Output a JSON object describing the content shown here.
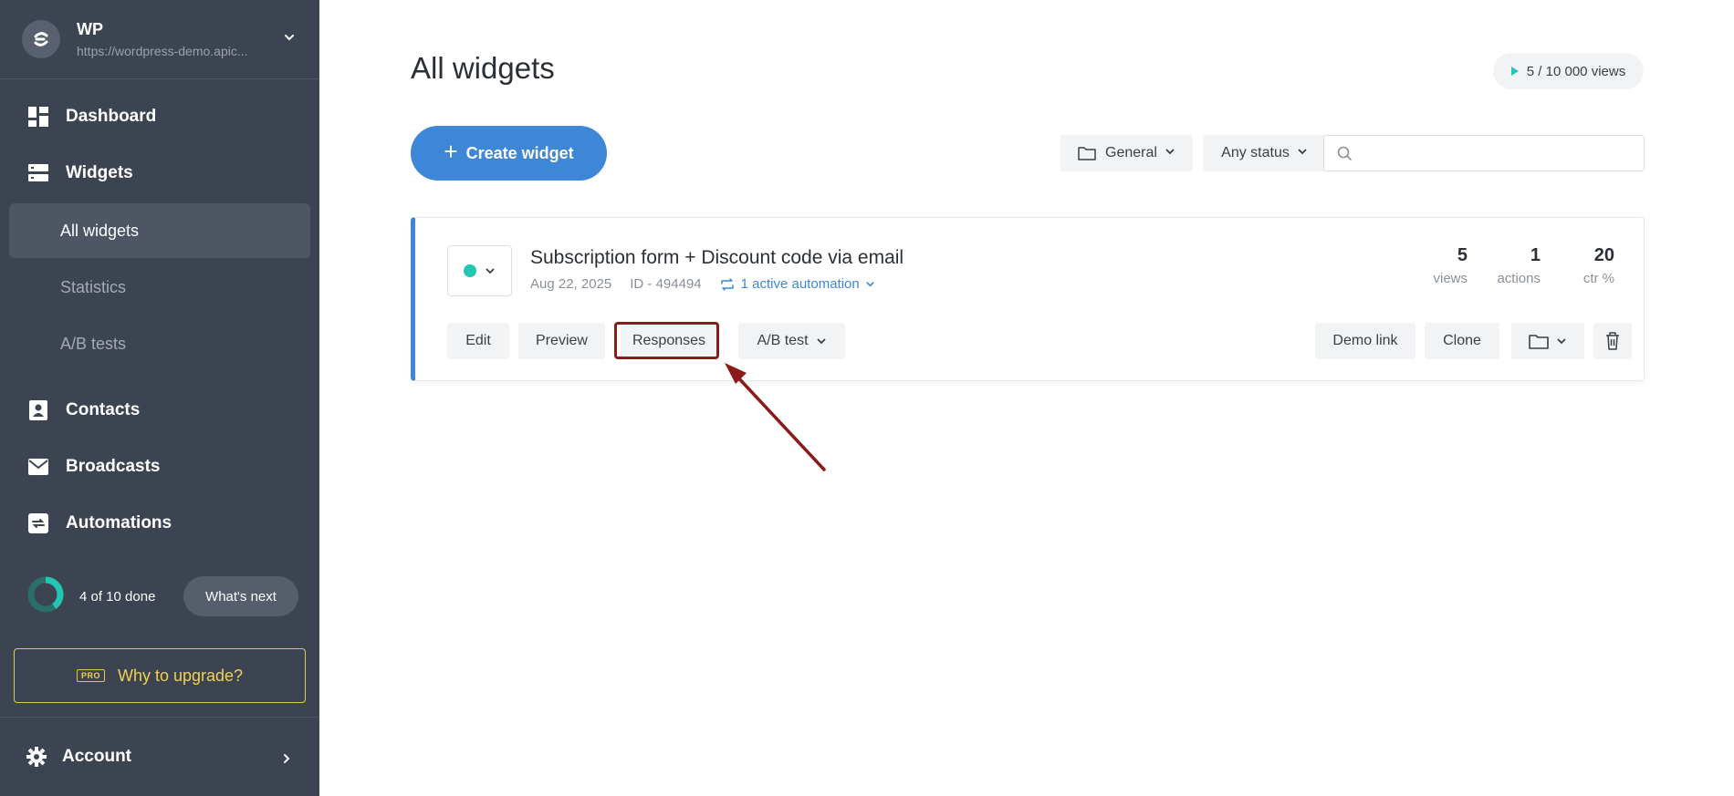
{
  "site": {
    "name": "WP",
    "url": "https://wordpress-demo.apic..."
  },
  "sidebar": {
    "items": [
      {
        "label": "Dashboard",
        "icon": "dashboard-icon"
      },
      {
        "label": "Widgets",
        "icon": "widgets-icon"
      },
      {
        "label": "Contacts",
        "icon": "contacts-icon"
      },
      {
        "label": "Broadcasts",
        "icon": "envelope-icon"
      },
      {
        "label": "Automations",
        "icon": "automations-icon"
      }
    ],
    "widget_subitems": [
      "All widgets",
      "Statistics",
      "A/B tests"
    ],
    "active_subitem": "All widgets",
    "progress": {
      "text": "4 of 10 done",
      "done": 4,
      "total": 10,
      "button": "What's next"
    },
    "upgrade": {
      "badge": "PRO",
      "label": "Why to upgrade?"
    },
    "account": {
      "label": "Account",
      "icon": "gear-icon"
    }
  },
  "main": {
    "title": "All widgets",
    "views_usage": "5 / 10 000 views",
    "create_button": "Create widget",
    "filters": {
      "folder": "General",
      "status": "Any status"
    },
    "search": {
      "placeholder": ""
    }
  },
  "widget": {
    "name": "Subscription form + Discount code via email",
    "date": "Aug 22, 2025",
    "id_label": "ID - 494494",
    "automation_label": "1 active automation",
    "status_color": "#21c7b0",
    "stats": [
      {
        "value": "5",
        "label": "views"
      },
      {
        "value": "1",
        "label": "actions"
      },
      {
        "value": "20",
        "label": "ctr %"
      }
    ],
    "actions": {
      "edit": "Edit",
      "preview": "Preview",
      "responses": "Responses",
      "ab_test": "A/B test",
      "demo_link": "Demo link",
      "clone": "Clone"
    }
  },
  "colors": {
    "sidebar_bg": "#3d4451",
    "accent_blue": "#3d87d6",
    "status_teal": "#21c7b0",
    "upgrade_yellow": "#f1d14e",
    "highlight_red": "#8b1a1a"
  }
}
